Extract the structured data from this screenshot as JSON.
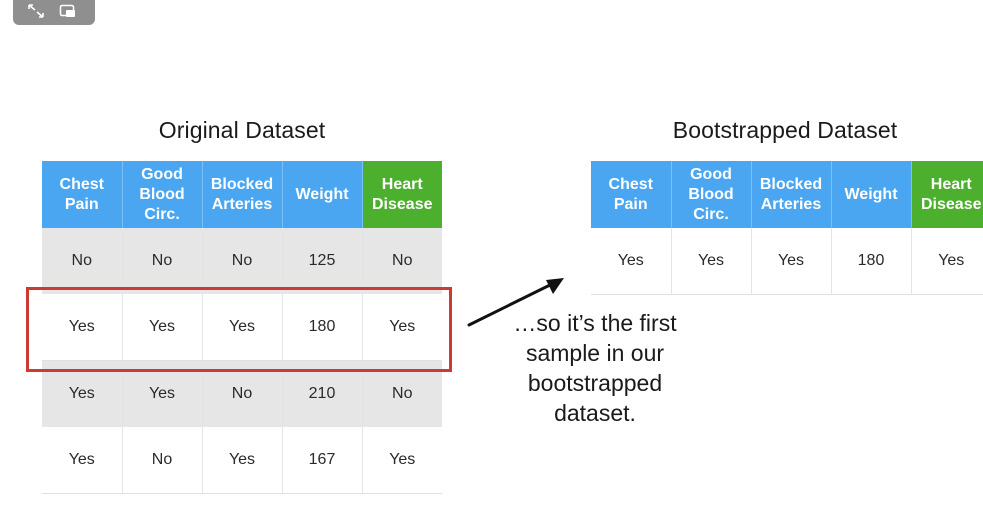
{
  "player": {
    "icons": [
      "expand-icon",
      "picture-in-picture-icon"
    ]
  },
  "original": {
    "title": "Original Dataset",
    "headers": [
      "Chest\nPain",
      "Good\nBlood\nCirc.",
      "Blocked\nArteries",
      "Weight",
      "Heart\nDisease"
    ],
    "rows": [
      [
        "No",
        "No",
        "No",
        "125",
        "No"
      ],
      [
        "Yes",
        "Yes",
        "Yes",
        "180",
        "Yes"
      ],
      [
        "Yes",
        "Yes",
        "No",
        "210",
        "No"
      ],
      [
        "Yes",
        "No",
        "Yes",
        "167",
        "Yes"
      ]
    ],
    "highlighted_row": 1
  },
  "bootstrapped": {
    "title": "Bootstrapped Dataset",
    "headers": [
      "Chest\nPain",
      "Good\nBlood\nCirc.",
      "Blocked\nArteries",
      "Weight",
      "Heart\nDisease"
    ],
    "rows": [
      [
        "Yes",
        "Yes",
        "Yes",
        "180",
        "Yes"
      ]
    ]
  },
  "caption": "…so it’s the first\nsample in our\nbootstrapped\ndataset.",
  "colors": {
    "feature_header": "#4ba6f2",
    "target_header": "#4caf2e",
    "highlight": "#cc3b33",
    "shaded_row": "#e6e6e6"
  }
}
